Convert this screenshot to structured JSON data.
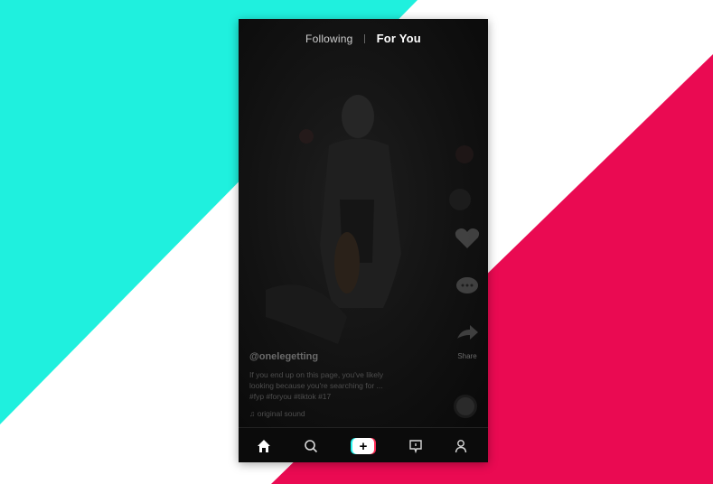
{
  "feed": {
    "tabs": [
      {
        "label": "Following",
        "active": false
      },
      {
        "label": "For You",
        "active": true
      }
    ]
  },
  "post": {
    "username": "@onelegetting",
    "caption_lines": [
      "If you end up on this page, you've likely",
      "looking because you're searching for ...",
      "#fyp #foryou #tiktok #17"
    ],
    "sound": "♫ original sound"
  },
  "side_actions": [
    {
      "icon": "heart-icon"
    },
    {
      "icon": "comment-icon"
    },
    {
      "icon": "share-icon",
      "count": "Share"
    }
  ],
  "nav": {
    "items": [
      {
        "icon": "home-icon",
        "active": true
      },
      {
        "icon": "search-icon"
      },
      {
        "icon": "create-icon",
        "label": "+"
      },
      {
        "icon": "inbox-icon"
      },
      {
        "icon": "profile-icon"
      }
    ]
  },
  "colors": {
    "cyan": "#25f4ee",
    "red": "#fe2c55",
    "background_cyan": "#1ff0de",
    "background_red": "#ea0a52",
    "phone_bg": "#0d0d0d"
  }
}
